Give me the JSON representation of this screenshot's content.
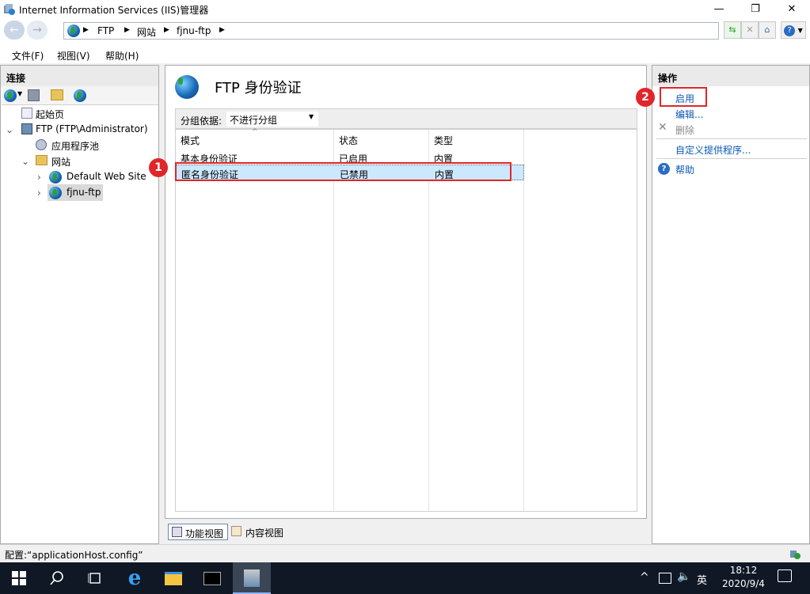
{
  "window": {
    "title": "Internet Information Services (IIS)管理器",
    "minimize": "—",
    "restore": "❐",
    "close": "✕"
  },
  "breadcrumb": {
    "items": [
      "FTP",
      "网站",
      "fjnu-ftp"
    ],
    "sep": "▶"
  },
  "menu": {
    "items": [
      "文件(F)",
      "视图(V)",
      "帮助(H)"
    ]
  },
  "connections": {
    "header": "连接",
    "tree": [
      {
        "label": "起始页"
      },
      {
        "label": "FTP (FTP\\Administrator)"
      },
      {
        "label": "应用程序池"
      },
      {
        "label": "网站"
      },
      {
        "label": "Default Web Site"
      },
      {
        "label": "fjnu-ftp"
      }
    ]
  },
  "main": {
    "title": "FTP 身份验证",
    "group_label": "分组依据:",
    "group_value": "不进行分组",
    "columns": [
      "模式",
      "状态",
      "类型"
    ],
    "rows": [
      {
        "mode": "基本身份验证",
        "status": "已启用",
        "type": "内置"
      },
      {
        "mode": "匿名身份验证",
        "status": "已禁用",
        "type": "内置"
      }
    ],
    "views": {
      "feature": "功能视图",
      "content": "内容视图"
    }
  },
  "actions": {
    "header": "操作",
    "enable": "启用",
    "edit": "编辑...",
    "delete": "删除",
    "custom": "自定义提供程序...",
    "help": "帮助"
  },
  "annotations": {
    "one": "1",
    "two": "2"
  },
  "statusbar": {
    "text": "配置:“applicationHost.config”"
  },
  "taskbar": {
    "tray_caret": "^",
    "ime": "英",
    "time": "18:12",
    "date": "2020/9/4"
  },
  "colors": {
    "accent_red": "#e0262a",
    "selection": "#cce8ff",
    "link": "#0a58b8",
    "taskbar": "#101826"
  }
}
